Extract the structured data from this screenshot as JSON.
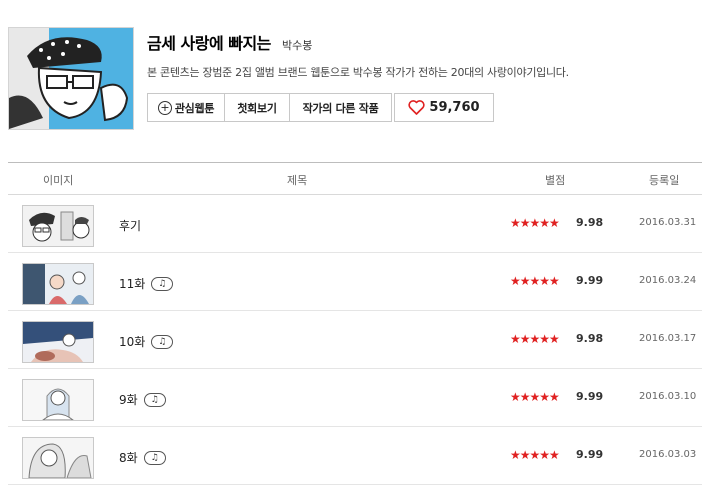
{
  "header": {
    "title": "금세 사랑에 빠지는",
    "author": "박수봉",
    "description": "본 콘텐츠는 장범준 2집 앨범 브랜드 웹툰으로 박수봉 작가가 전하는 20대의 사랑이야기입니다.",
    "buttons": {
      "favorite": "관심웹툰",
      "first_episode": "첫회보기",
      "other_works": "작가의 다른 작품"
    },
    "likes": "59,760"
  },
  "table": {
    "columns": {
      "image": "이미지",
      "title": "제목",
      "rating": "별점",
      "date": "등록일"
    },
    "rows": [
      {
        "title": "후기",
        "bgm": false,
        "stars": "★★★★★",
        "score": "9.98",
        "date": "2016.03.31"
      },
      {
        "title": "11화",
        "bgm": true,
        "stars": "★★★★★",
        "score": "9.99",
        "date": "2016.03.24"
      },
      {
        "title": "10화",
        "bgm": true,
        "stars": "★★★★★",
        "score": "9.98",
        "date": "2016.03.17"
      },
      {
        "title": "9화",
        "bgm": true,
        "stars": "★★★★★",
        "score": "9.99",
        "date": "2016.03.10"
      },
      {
        "title": "8화",
        "bgm": true,
        "stars": "★★★★★",
        "score": "9.99",
        "date": "2016.03.03"
      }
    ]
  },
  "colors": {
    "star": "#e02121",
    "heart": "#e02121",
    "thumb_bg": "#4fb2e2"
  },
  "icons": {
    "add": "plus-circle-icon",
    "like": "heart-icon",
    "bgm": "music-note-icon"
  }
}
